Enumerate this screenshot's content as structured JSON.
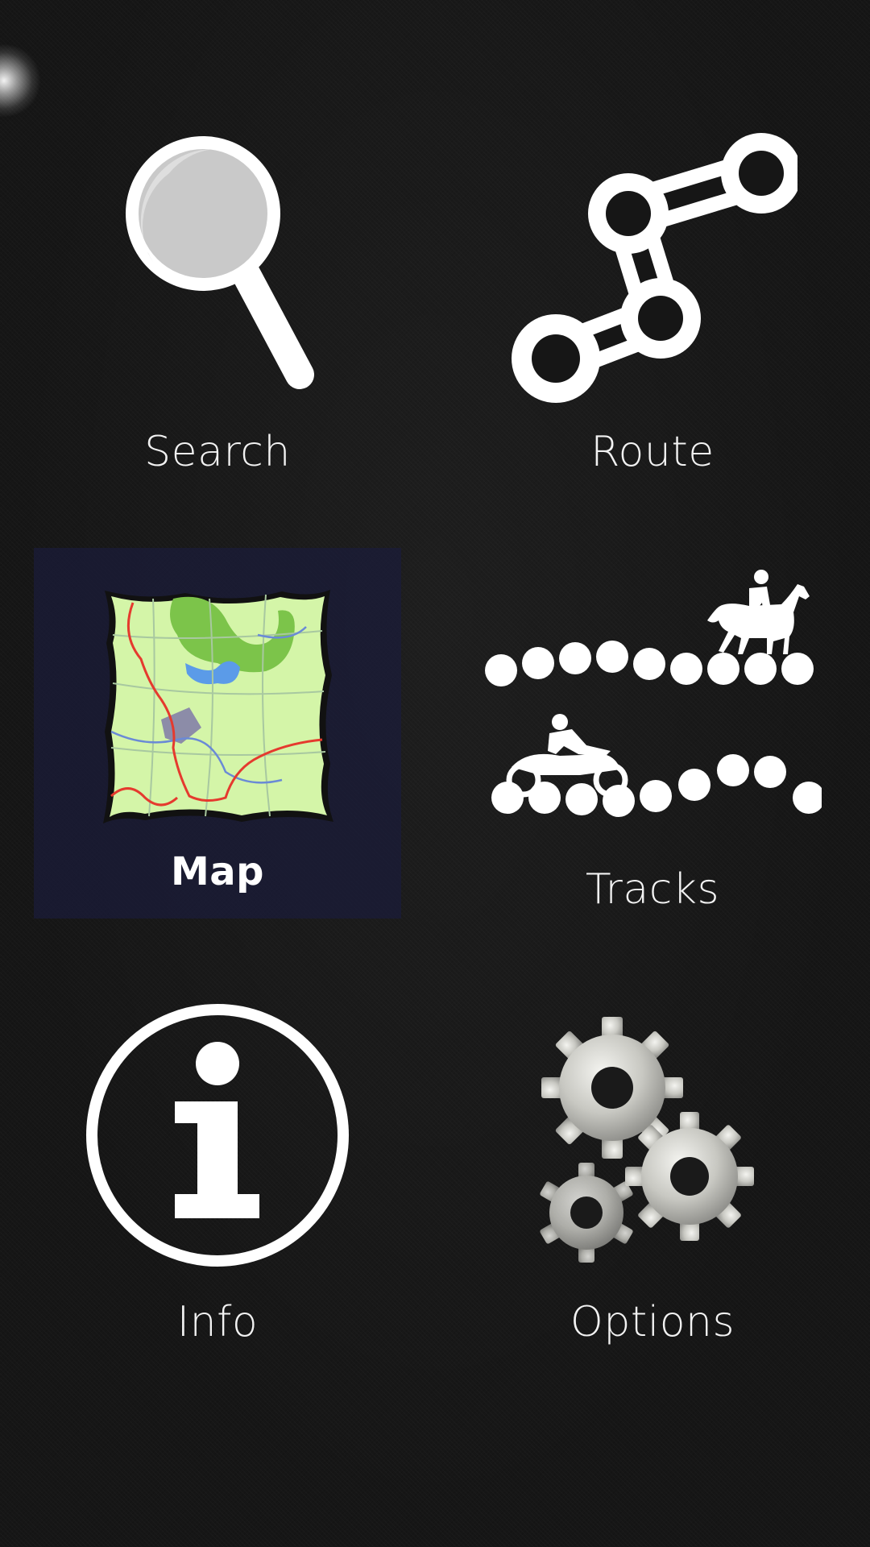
{
  "menu": {
    "items": [
      {
        "id": "search",
        "label": "Search",
        "icon": "magnifier-icon",
        "selected": false
      },
      {
        "id": "route",
        "label": "Route",
        "icon": "route-icon",
        "selected": false
      },
      {
        "id": "map",
        "label": "Map",
        "icon": "map-icon",
        "selected": true
      },
      {
        "id": "tracks",
        "label": "Tracks",
        "icon": "tracks-icon",
        "selected": false
      },
      {
        "id": "info",
        "label": "Info",
        "icon": "info-icon",
        "selected": false
      },
      {
        "id": "options",
        "label": "Options",
        "icon": "gears-icon",
        "selected": false
      }
    ]
  },
  "colors": {
    "background": "#161616",
    "selected_tile": "#1a1c3a",
    "icon_white": "#ffffff",
    "map_paper": "#d4f5a8",
    "map_forest": "#7cc44a",
    "map_water": "#5b9be8",
    "map_route_red": "#e53a2e"
  }
}
